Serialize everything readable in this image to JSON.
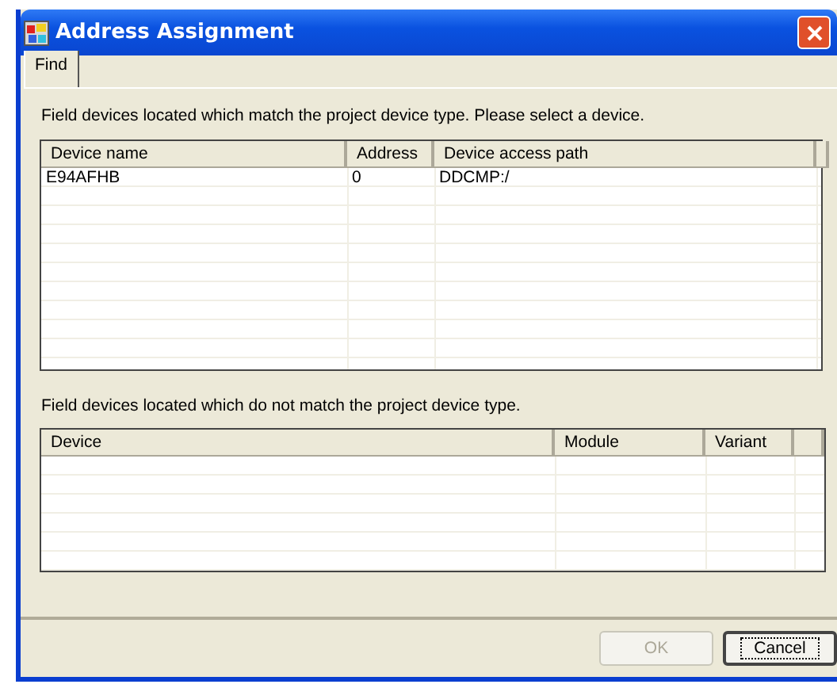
{
  "window": {
    "title": "Address Assignment"
  },
  "tabs": [
    {
      "label": "Find",
      "selected": true
    }
  ],
  "matching": {
    "caption": "Field devices located which match the project device type. Please select a device.",
    "columns": [
      "Device name",
      "Address",
      "Device access path"
    ],
    "rows": [
      [
        "E94AFHB",
        "0",
        "DDCMP:/"
      ]
    ]
  },
  "other": {
    "caption": "Field devices located which do not match the project device type.",
    "columns": [
      "Device",
      "Module",
      "Variant"
    ]
  },
  "buttons": [
    {
      "label": "OK",
      "disabled": true,
      "focused": false
    },
    {
      "label": "Cancel",
      "disabled": false,
      "focused": true
    }
  ]
}
